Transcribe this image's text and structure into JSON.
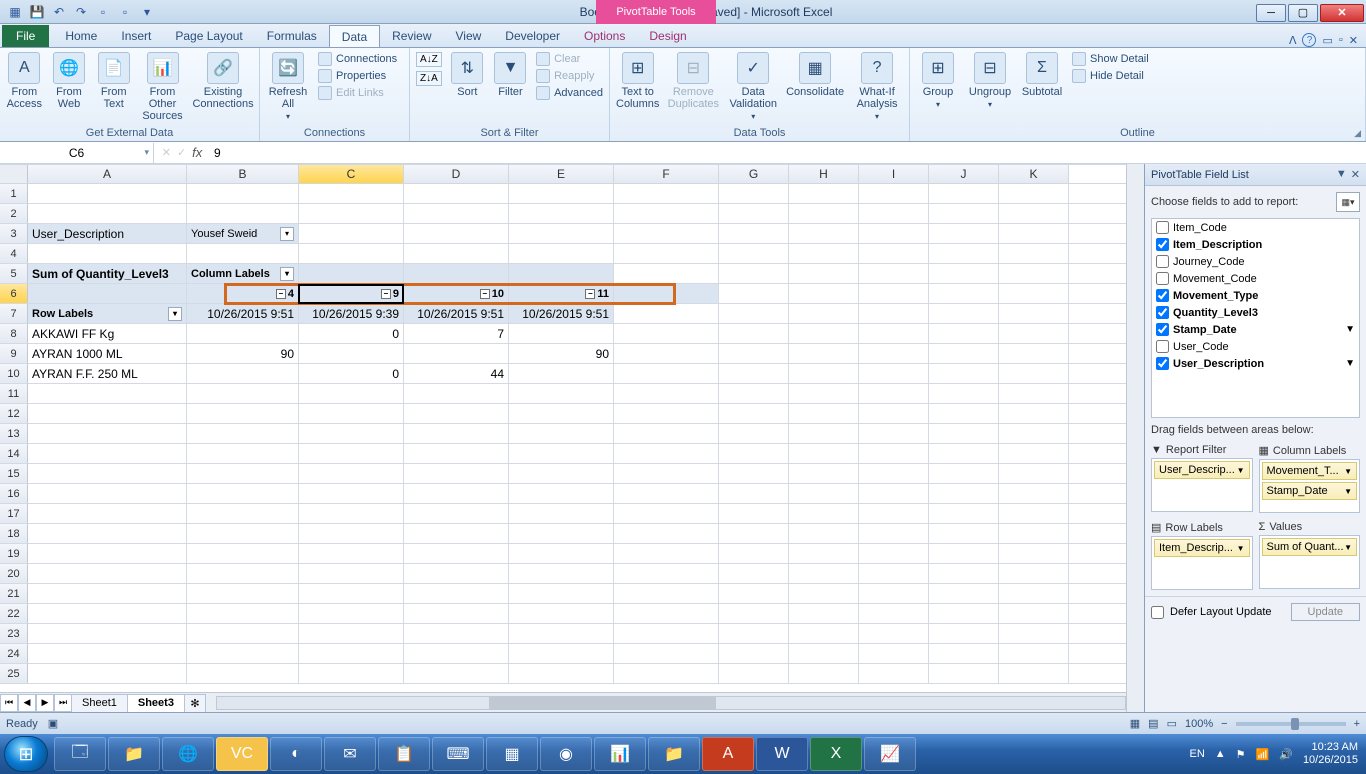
{
  "title": "Book1 (version 1) [Autosaved] - Microsoft Excel",
  "ctx_tools": "PivotTable Tools",
  "tabs": {
    "file": "File",
    "list": [
      "Home",
      "Insert",
      "Page Layout",
      "Formulas",
      "Data",
      "Review",
      "View",
      "Developer"
    ],
    "ctx": [
      "Options",
      "Design"
    ],
    "active": "Data"
  },
  "ribbon": {
    "grp1": {
      "label": "Get External Data",
      "btns": [
        "From Access",
        "From Web",
        "From Text",
        "From Other Sources",
        "Existing Connections"
      ]
    },
    "grp2": {
      "label": "Connections",
      "refresh": "Refresh All",
      "links": [
        "Connections",
        "Properties",
        "Edit Links"
      ]
    },
    "grp3": {
      "label": "Sort & Filter",
      "sort": "Sort",
      "filter": "Filter",
      "links": [
        "Clear",
        "Reapply",
        "Advanced"
      ]
    },
    "grp4": {
      "label": "Data Tools",
      "btns": [
        "Text to Columns",
        "Remove Duplicates",
        "Data Validation",
        "Consolidate",
        "What-If Analysis"
      ]
    },
    "grp5": {
      "label": "Outline",
      "btns": [
        "Group",
        "Ungroup",
        "Subtotal"
      ],
      "show": "Show Detail",
      "hide": "Hide Detail"
    }
  },
  "namebox": "C6",
  "formula": "9",
  "columns": [
    "A",
    "B",
    "C",
    "D",
    "E",
    "F",
    "G",
    "H",
    "I",
    "J",
    "K"
  ],
  "pivot": {
    "filter_label": "User_Description",
    "filter_value": "Yousef Sweid",
    "sum_label": "Sum of Quantity_Level3",
    "col_labels_label": "Column Labels",
    "row_labels_label": "Row Labels",
    "col_groups": [
      "4",
      "9",
      "10",
      "11"
    ],
    "col_dates": [
      "10/26/2015 9:51",
      "10/26/2015 9:39",
      "10/26/2015 9:51",
      "10/26/2015 9:51"
    ],
    "rows": [
      {
        "label": "AKKAWI FF Kg",
        "vals": [
          "",
          "0",
          "7",
          ""
        ]
      },
      {
        "label": "AYRAN 1000 ML",
        "vals": [
          "90",
          "",
          "",
          "90"
        ]
      },
      {
        "label": "AYRAN F.F. 250 ML",
        "vals": [
          "",
          "0",
          "44",
          ""
        ]
      }
    ]
  },
  "fieldlist": {
    "title": "PivotTable Field List",
    "choose": "Choose fields to add to report:",
    "fields": [
      {
        "name": "Item_Code",
        "checked": false
      },
      {
        "name": "Item_Description",
        "checked": true
      },
      {
        "name": "Journey_Code",
        "checked": false
      },
      {
        "name": "Movement_Code",
        "checked": false
      },
      {
        "name": "Movement_Type",
        "checked": true
      },
      {
        "name": "Quantity_Level3",
        "checked": true
      },
      {
        "name": "Stamp_Date",
        "checked": true,
        "filter": true
      },
      {
        "name": "User_Code",
        "checked": false
      },
      {
        "name": "User_Description",
        "checked": true,
        "filter": true
      }
    ],
    "drag": "Drag fields between areas below:",
    "areas": {
      "report_filter": {
        "label": "Report Filter",
        "items": [
          "User_Descrip..."
        ]
      },
      "column_labels": {
        "label": "Column Labels",
        "items": [
          "Movement_T...",
          "Stamp_Date"
        ]
      },
      "row_labels": {
        "label": "Row Labels",
        "items": [
          "Item_Descrip..."
        ]
      },
      "values": {
        "label": "Values",
        "items": [
          "Sum of Quant..."
        ]
      }
    },
    "defer": "Defer Layout Update",
    "update": "Update"
  },
  "sheets": {
    "list": [
      "Sheet1",
      "Sheet3"
    ],
    "active": "Sheet3"
  },
  "status": {
    "ready": "Ready",
    "zoom": "100%"
  },
  "taskbar": {
    "lang": "EN",
    "time": "10:23 AM",
    "date": "10/26/2015"
  }
}
